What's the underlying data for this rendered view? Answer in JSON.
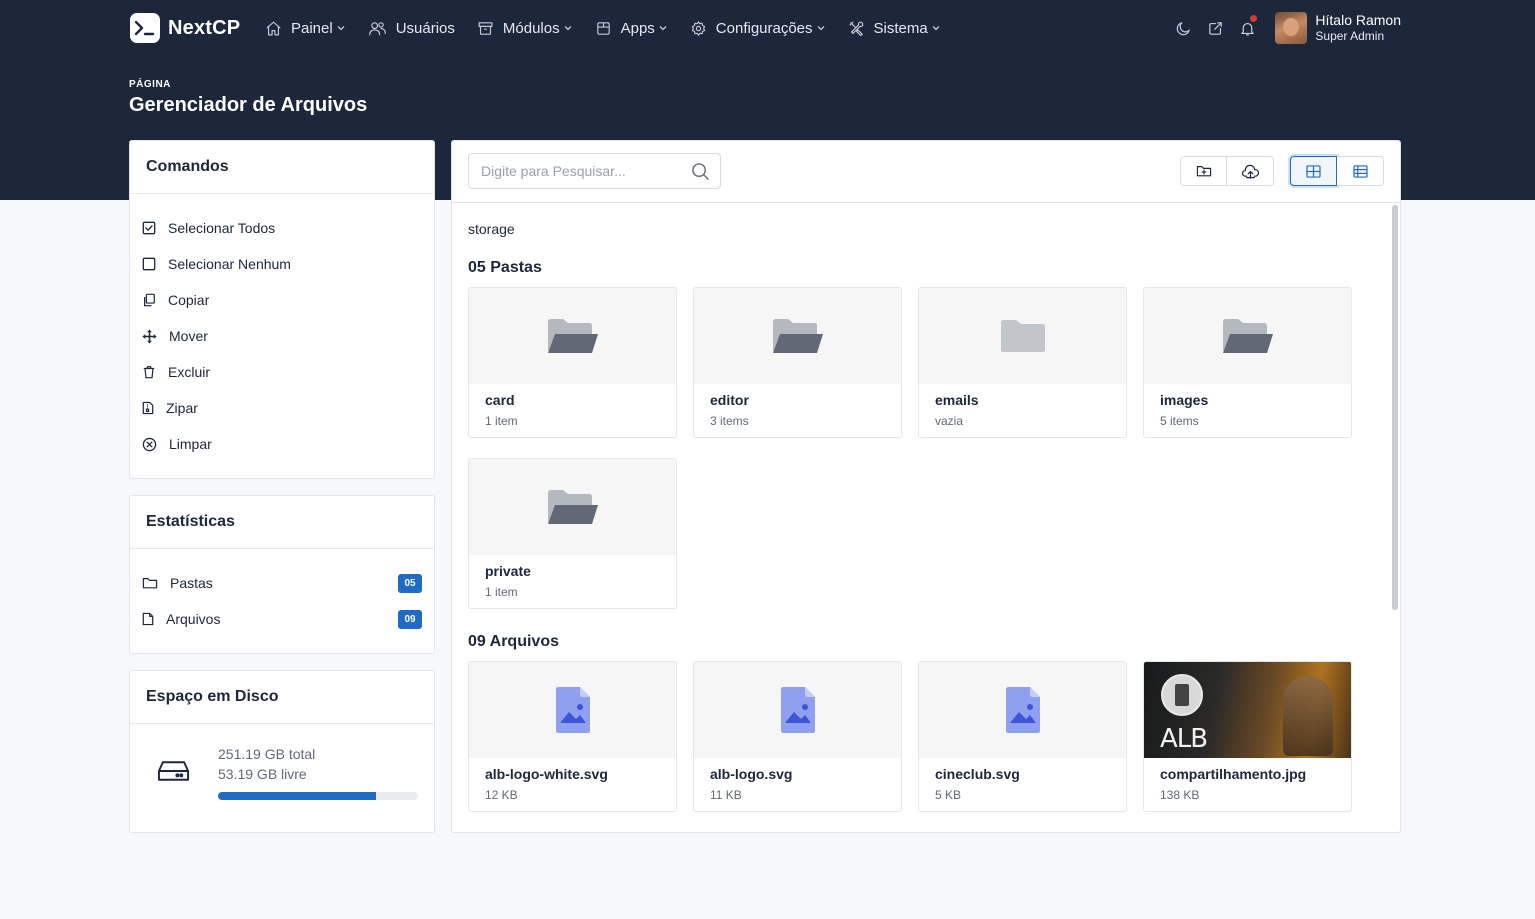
{
  "brand": {
    "name": "NextCP"
  },
  "nav": [
    {
      "label": "Painel",
      "icon": "home-icon",
      "dropdown": true
    },
    {
      "label": "Usuários",
      "icon": "users-icon",
      "dropdown": false
    },
    {
      "label": "Módulos",
      "icon": "package-icon",
      "dropdown": true
    },
    {
      "label": "Apps",
      "icon": "apps-icon",
      "dropdown": true
    },
    {
      "label": "Configurações",
      "icon": "gear-icon",
      "dropdown": true
    },
    {
      "label": "Sistema",
      "icon": "tools-icon",
      "dropdown": true
    }
  ],
  "user": {
    "name": "Hítalo Ramon",
    "role": "Super Admin"
  },
  "page": {
    "pretitle": "PÁGINA",
    "title": "Gerenciador de Arquivos"
  },
  "commands": {
    "title": "Comandos",
    "items": [
      {
        "label": "Selecionar Todos",
        "icon": "checkbox-checked-icon"
      },
      {
        "label": "Selecionar Nenhum",
        "icon": "checkbox-empty-icon"
      },
      {
        "label": "Copiar",
        "icon": "copy-icon"
      },
      {
        "label": "Mover",
        "icon": "move-icon"
      },
      {
        "label": "Excluir",
        "icon": "trash-icon"
      },
      {
        "label": "Zipar",
        "icon": "zip-icon"
      },
      {
        "label": "Limpar",
        "icon": "clear-icon"
      }
    ]
  },
  "stats": {
    "title": "Estatísticas",
    "items": [
      {
        "label": "Pastas",
        "count": "05",
        "icon": "folder-icon"
      },
      {
        "label": "Arquivos",
        "count": "09",
        "icon": "file-icon"
      }
    ]
  },
  "disk": {
    "title": "Espaço em Disco",
    "total": "251.19 GB total",
    "free": "53.19 GB livre",
    "used_fraction": 0.79
  },
  "search": {
    "placeholder": "Digite para Pesquisar..."
  },
  "breadcrumb": "storage",
  "folders": {
    "title": "05 Pastas",
    "items": [
      {
        "name": "card",
        "sub": "1 item",
        "open": true
      },
      {
        "name": "editor",
        "sub": "3 items",
        "open": true
      },
      {
        "name": "emails",
        "sub": "vazia",
        "open": false
      },
      {
        "name": "images",
        "sub": "5 items",
        "open": true
      },
      {
        "name": "private",
        "sub": "1 item",
        "open": true
      }
    ]
  },
  "files": {
    "title": "09 Arquivos",
    "items": [
      {
        "name": "alb-logo-white.svg",
        "sub": "12 KB"
      },
      {
        "name": "alb-logo.svg",
        "sub": "11 KB"
      },
      {
        "name": "cineclub.svg",
        "sub": "5 KB"
      },
      {
        "name": "compartilhamento.jpg",
        "sub": "138 KB",
        "thumb_text": "ALB"
      }
    ]
  },
  "colors": {
    "primary": "#206bc4",
    "header_bg": "#1d273b",
    "notification": "#d63939"
  }
}
